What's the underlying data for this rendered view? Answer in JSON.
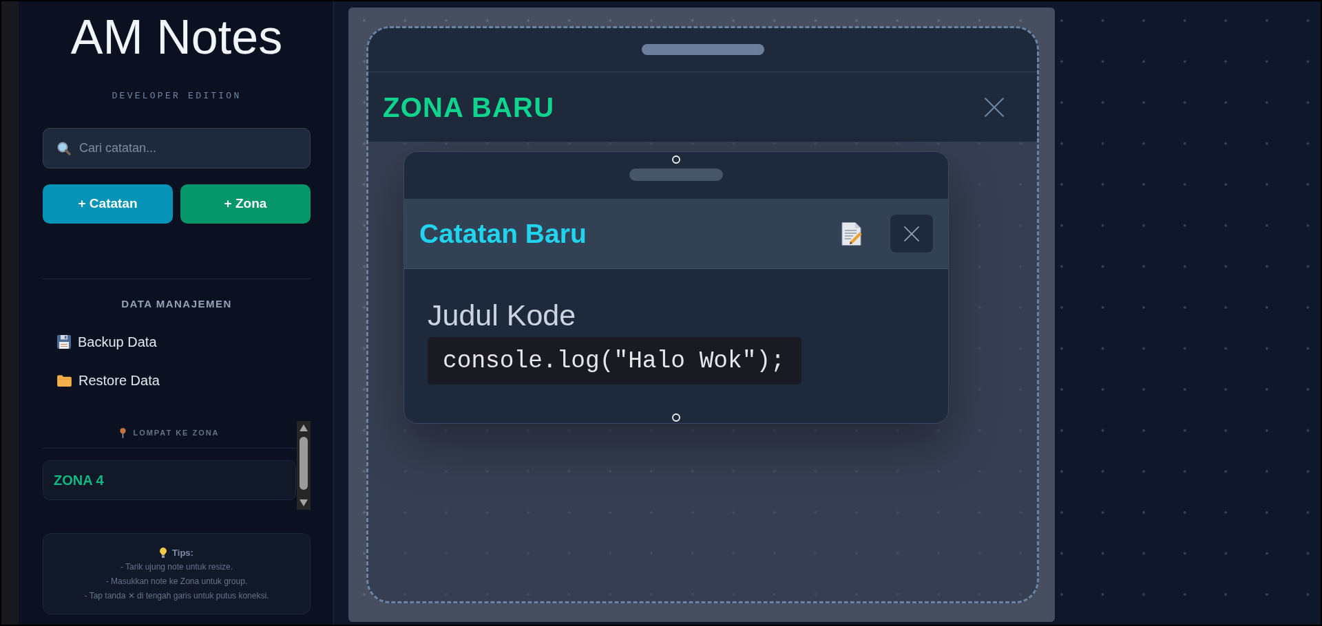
{
  "sidebar": {
    "title": "AM Notes",
    "subtitle": "DEVELOPER EDITION",
    "search": {
      "placeholder": "Cari catatan..."
    },
    "buttons": [
      {
        "label": "+ Catatan",
        "kind": "note"
      },
      {
        "label": "+ Zona",
        "kind": "zone"
      }
    ],
    "data_section": {
      "heading": "DATA MANAJEMEN",
      "items": [
        {
          "label": "Backup Data",
          "kind": "backup"
        },
        {
          "label": "Restore Data",
          "kind": "restore"
        }
      ]
    },
    "jump_section": {
      "heading": "LOMPAT KE ZONA",
      "zones": [
        {
          "label": "ZONA 4"
        }
      ]
    },
    "tips": {
      "heading": "Tips:",
      "lines": [
        "- Tarik ujung note untuk resize.",
        "- Masukkan note ke Zona untuk group.",
        "- Tap tanda ✕ di tengah garis untuk putus koneksi."
      ]
    }
  },
  "canvas": {
    "zone": {
      "title": "ZONA BARU"
    },
    "note": {
      "title": "Catatan Baru",
      "heading": "Judul Kode",
      "code": "console.log(\"Halo Wok\");"
    }
  }
}
